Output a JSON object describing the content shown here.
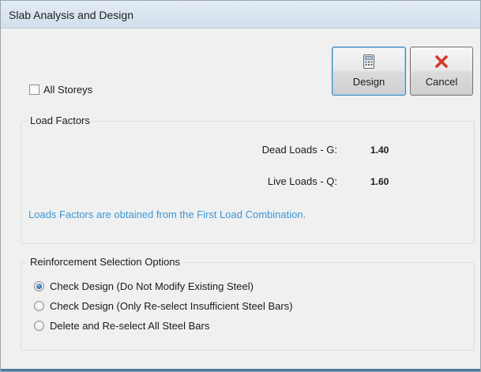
{
  "window": {
    "title": "Slab Analysis and Design"
  },
  "options": {
    "all_storeys_label": "All Storeys",
    "all_storeys_checked": false
  },
  "buttons": {
    "design_label": "Design",
    "cancel_label": "Cancel"
  },
  "load_factors": {
    "title": "Load Factors",
    "dead_label": "Dead Loads - G:",
    "dead_value": "1.40",
    "live_label": "Live Loads - Q:",
    "live_value": "1.60",
    "note": "Loads Factors are obtained from the First Load Combination."
  },
  "reinforcement": {
    "title": "Reinforcement Selection Options",
    "options": [
      {
        "label": "Check Design (Do Not Modify Existing Steel)",
        "selected": true
      },
      {
        "label": "Check Design (Only Re-select Insufficient Steel Bars)",
        "selected": false
      },
      {
        "label": "Delete and Re-select All Steel Bars",
        "selected": false
      }
    ]
  },
  "colors": {
    "note_text": "#3a96d6",
    "cancel_icon": "#d13a2a",
    "title_bar": "#dbe6f0"
  },
  "icons": {
    "design": "calculator-icon",
    "cancel": "red-x-icon"
  }
}
